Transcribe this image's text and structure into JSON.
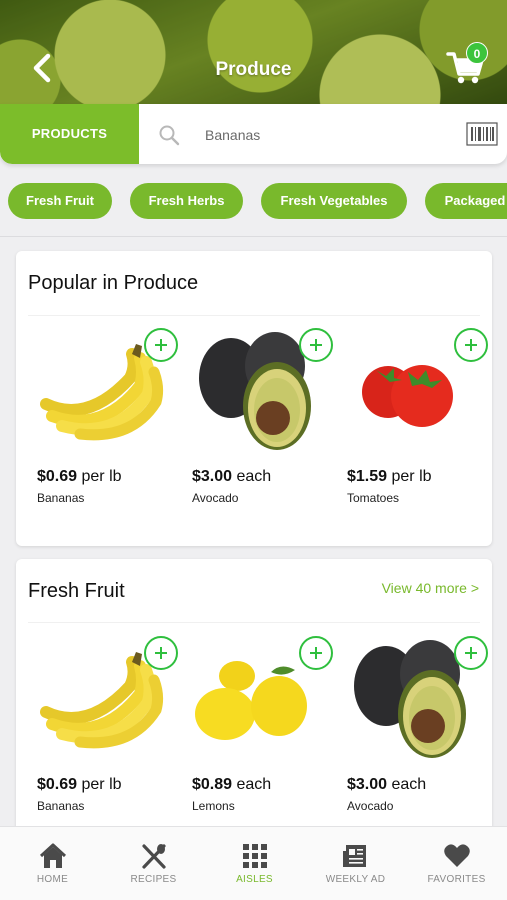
{
  "header": {
    "title": "Produce",
    "cart_count": "0"
  },
  "search": {
    "tab_label": "PRODUCTS",
    "placeholder": "Bananas"
  },
  "chips": [
    "Fresh Fruit",
    "Fresh Herbs",
    "Fresh Vegetables",
    "Packaged"
  ],
  "popular": {
    "title": "Popular in Produce",
    "items": [
      {
        "price": "$0.69",
        "unit": " per lb",
        "name": "Bananas",
        "image_icon": "banana-bunch"
      },
      {
        "price": "$3.00",
        "unit": " each",
        "name": "Avocado",
        "image_icon": "avocado"
      },
      {
        "price": "$1.59",
        "unit": " per lb",
        "name": "Tomatoes",
        "image_icon": "tomatoes"
      }
    ]
  },
  "fresh_fruit": {
    "title": "Fresh Fruit",
    "view_more": "View 40 more >",
    "items": [
      {
        "price": "$0.69",
        "unit": " per lb",
        "name": "Bananas",
        "image_icon": "banana-bunch"
      },
      {
        "price": "$0.89",
        "unit": " each",
        "name": "Lemons",
        "image_icon": "lemons"
      },
      {
        "price": "$3.00",
        "unit": " each",
        "name": "Avocado",
        "image_icon": "avocado"
      }
    ]
  },
  "nav": {
    "items": [
      {
        "label": "HOME",
        "icon": "home-icon",
        "active": false
      },
      {
        "label": "RECIPES",
        "icon": "utensils-icon",
        "active": false
      },
      {
        "label": "AISLES",
        "icon": "grid-icon",
        "active": true
      },
      {
        "label": "WEEKLY AD",
        "icon": "newspaper-icon",
        "active": false
      },
      {
        "label": "FAVORITES",
        "icon": "heart-icon",
        "active": false
      }
    ]
  },
  "colors": {
    "accent": "#79b92c",
    "add_button": "#2fbf3e",
    "badge": "#3cc43c"
  }
}
